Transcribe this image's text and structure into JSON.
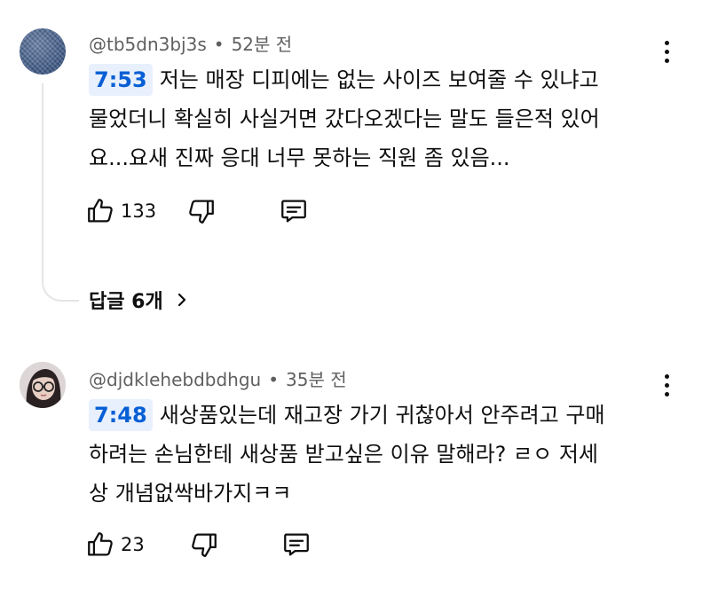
{
  "comments": [
    {
      "author": "@tb5dn3bj3s",
      "separator": "•",
      "time": "52분 전",
      "timestamp": "7:53",
      "text_lines": [
        "저는 매장 디피에는 없는 사이즈 보여줄 수 있냐고",
        "물었더니 확실히 사실거면 갔다오겠다는 말도 들은적 있어",
        "요...요새 진짜 응대 너무 못하는 직원 좀 있음..."
      ],
      "likes": "133",
      "replies_label": "답글 6개"
    },
    {
      "author": "@djdklehebdbdhgu",
      "separator": "•",
      "time": "35분 전",
      "timestamp": "7:48",
      "text_lines": [
        "새상품있는데 재고장 가기 귀찮아서 안주려고 구매",
        "하려는 손님한테 새상품 받고싶은 이유 말해라? ㄹㅇ 저세",
        "상 개념없싹바가지ㅋㅋ"
      ],
      "likes": "23"
    }
  ],
  "icons": {
    "like": "thumbs-up-icon",
    "dislike": "thumbs-down-icon",
    "reply": "comment-reply-icon",
    "more": "more-vertical-icon",
    "chevron": "chevron-right-icon"
  },
  "colors": {
    "timestamp_bg": "#e8f0fe",
    "timestamp_text": "#065fd4",
    "meta_text": "#606060"
  }
}
